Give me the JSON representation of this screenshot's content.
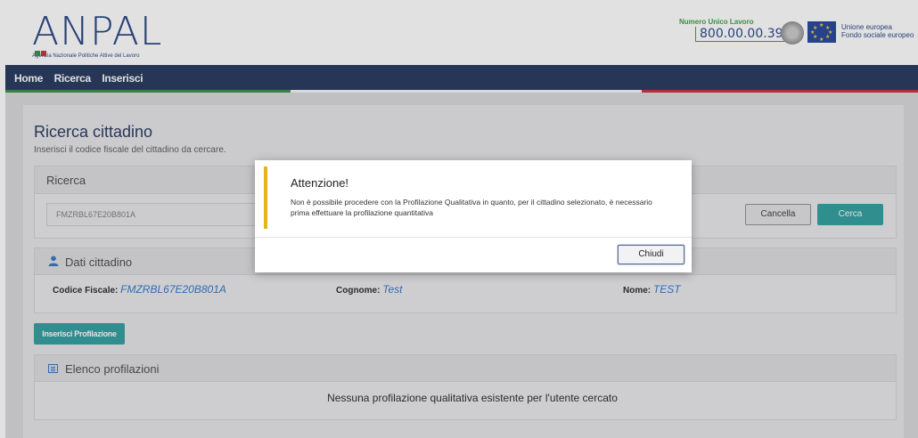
{
  "header": {
    "logo_text": "ANPAL",
    "logo_subtitle": "Agenzia Nazionale Politiche Attive del Lavoro",
    "numero_label": "Numero Unico Lavoro",
    "numero_value": "800.00.00.39",
    "eu_text_line1": "Unione europea",
    "eu_text_line2": "Fondo sociale europeo"
  },
  "nav": {
    "items": [
      {
        "label": "Home"
      },
      {
        "label": "Ricerca"
      },
      {
        "label": "Inserisci"
      }
    ]
  },
  "page": {
    "title": "Ricerca cittadino",
    "subtitle": "Inserisci il codice fiscale del cittadino da cercare."
  },
  "ricerca_card": {
    "title": "Ricerca",
    "input_value": "FMZRBL67E20B801A",
    "cancel_label": "Cancella",
    "search_label": "Cerca"
  },
  "dati_card": {
    "title": "Dati cittadino",
    "codice_label": "Codice Fiscale:",
    "codice_value": "FMZRBL67E20B801A",
    "cognome_label": "Cognome:",
    "cognome_value": "Test",
    "nome_label": "Nome:",
    "nome_value": "TEST"
  },
  "inserisci_button": "Inserisci Profilazione",
  "elenco_card": {
    "title": "Elenco profilazioni",
    "empty_message": "Nessuna profilazione qualitativa esistente per l'utente cercato"
  },
  "modal": {
    "title": "Attenzione!",
    "body": "Non è possibile procedere con la Profilazione Qualitativa in quanto, per il cittadino selezionato, è necessario prima effettuare la profilazione quantitativa",
    "close_label": "Chiudi"
  },
  "colors": {
    "nav": "#1b2f55",
    "accent_teal": "#289a9a",
    "warning_bar": "#e6b31a",
    "italia_green": "#2e8b3e",
    "italia_red": "#c8282e"
  }
}
